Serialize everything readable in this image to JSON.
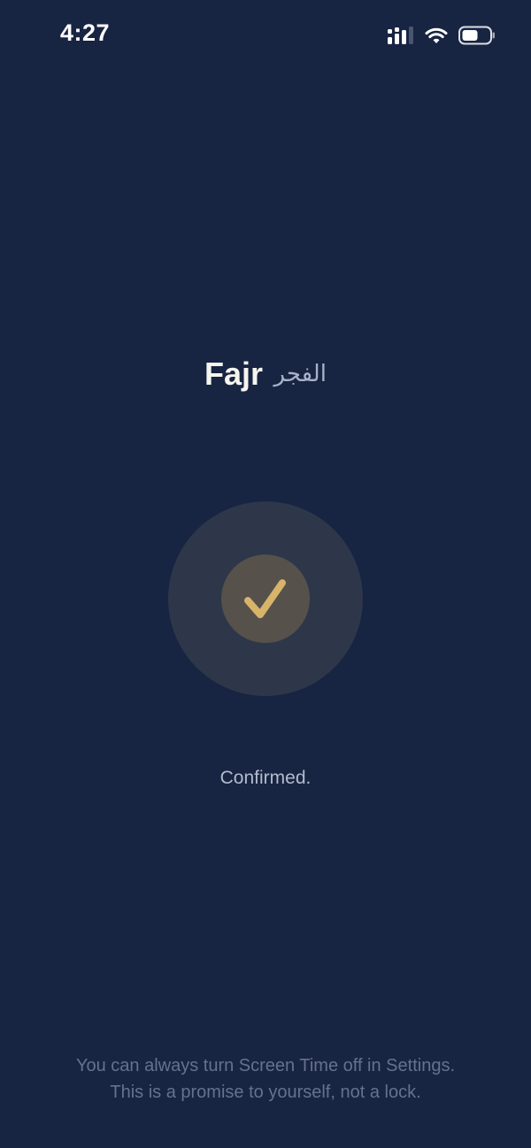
{
  "status_bar": {
    "time": "4:27",
    "icons": [
      "cellular-signal-icon",
      "wifi-icon",
      "battery-icon"
    ]
  },
  "prayer": {
    "name_en": "Fajr",
    "name_ar": "الفجر"
  },
  "confirmation": {
    "icon": "checkmark-icon",
    "accent_color": "#d7b46a",
    "text": "Confirmed."
  },
  "footer": {
    "line1": "You can always turn Screen Time off in Settings.",
    "line2": "This is a promise to yourself, not a lock."
  },
  "colors": {
    "background": "#172442"
  }
}
